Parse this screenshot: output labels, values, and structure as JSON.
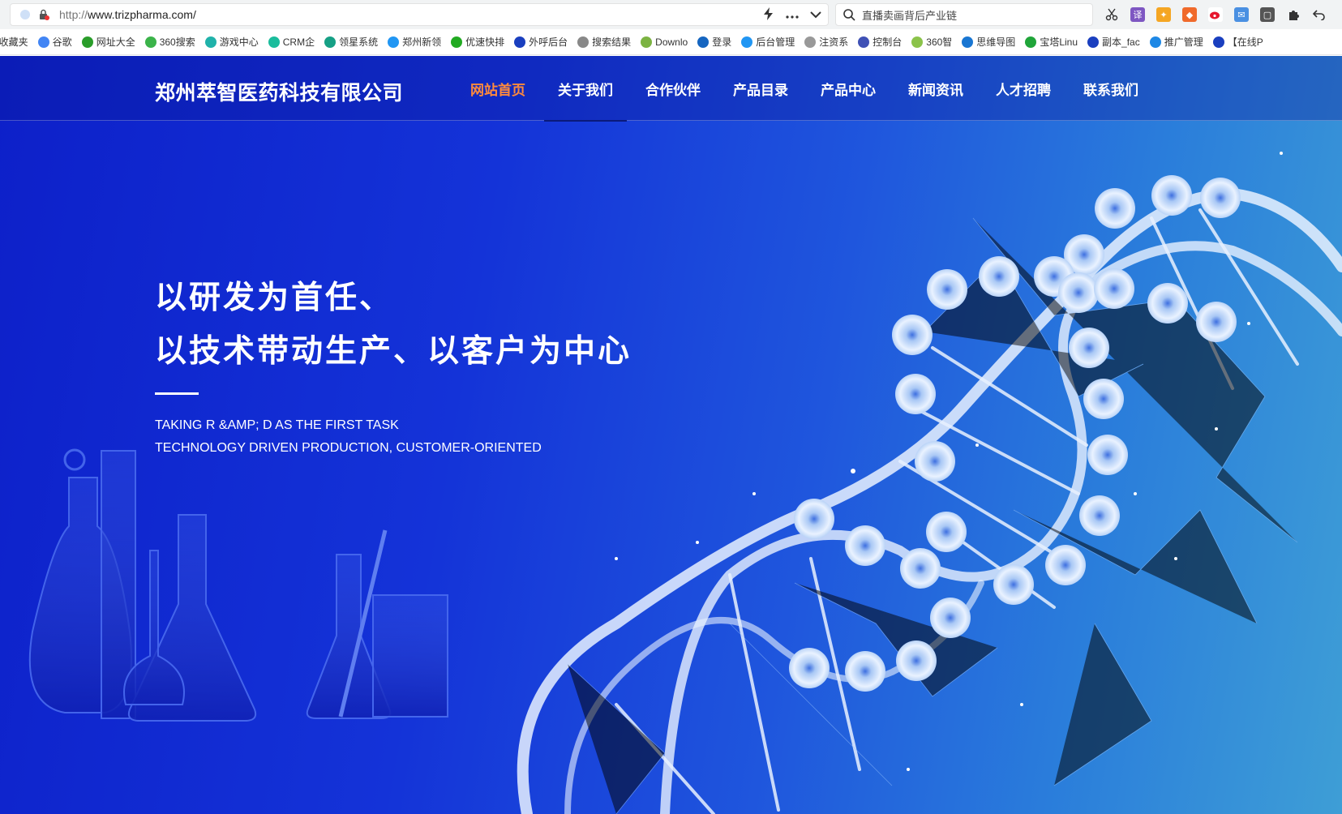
{
  "browser": {
    "url_protocol": "http://",
    "url_host": "www.trizpharma.com/",
    "search_placeholder": "直播卖画背后产业链",
    "bookmarks": [
      {
        "label": "l收藏夹",
        "color": "#e44"
      },
      {
        "label": "谷歌",
        "color": "#4285f4"
      },
      {
        "label": "网址大全",
        "color": "#2a9d2a"
      },
      {
        "label": "360搜索",
        "color": "#3bb34a"
      },
      {
        "label": "游戏中心",
        "color": "#20b2aa"
      },
      {
        "label": "CRM企",
        "color": "#1abc9c"
      },
      {
        "label": "领星系统",
        "color": "#16a085"
      },
      {
        "label": "郑州新领",
        "color": "#2196f3"
      },
      {
        "label": "优速快排",
        "color": "#22aa22"
      },
      {
        "label": "外呼后台",
        "color": "#1a3fbf"
      },
      {
        "label": "搜索结果",
        "color": "#888"
      },
      {
        "label": "Downlo",
        "color": "#7cb342"
      },
      {
        "label": "登录",
        "color": "#1565c0"
      },
      {
        "label": "后台管理",
        "color": "#2196f3"
      },
      {
        "label": "注资系",
        "color": "#999"
      },
      {
        "label": "控制台",
        "color": "#3f51b5"
      },
      {
        "label": "360智",
        "color": "#8bc34a"
      },
      {
        "label": "思维导图",
        "color": "#1976d2"
      },
      {
        "label": "宝塔Linu",
        "color": "#20a53a"
      },
      {
        "label": "副本_fac",
        "color": "#1a3fbf"
      },
      {
        "label": "推广管理",
        "color": "#1e88e5"
      },
      {
        "label": "【在线P",
        "color": "#1a3fbf"
      }
    ]
  },
  "site": {
    "logo": "郑州萃智医药科技有限公司",
    "menu": [
      {
        "label": "网站首页",
        "active": true
      },
      {
        "label": "关于我们",
        "active": false
      },
      {
        "label": "合作伙伴",
        "active": false
      },
      {
        "label": "产品目录",
        "active": false
      },
      {
        "label": "产品中心",
        "active": false
      },
      {
        "label": "新闻资讯",
        "active": false
      },
      {
        "label": "人才招聘",
        "active": false
      },
      {
        "label": "联系我们",
        "active": false
      }
    ],
    "hero": {
      "title_line1": "以研发为首任、",
      "title_line2": "以技术带动生产、以客户为中心",
      "subtitle_line1": "TAKING R &AMP; D AS THE FIRST TASK",
      "subtitle_line2": "TECHNOLOGY DRIVEN PRODUCTION, CUSTOMER-ORIENTED"
    }
  },
  "colors": {
    "active_menu": "#ff8a3c",
    "hero_bg_start": "#0d20c9",
    "hero_bg_end": "#3e9ed6"
  }
}
